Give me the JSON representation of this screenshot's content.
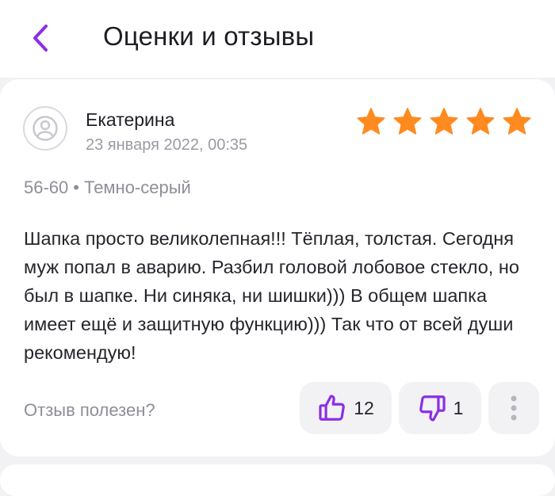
{
  "header": {
    "title": "Оценки и отзывы",
    "back_icon": "chevron-left-icon"
  },
  "review": {
    "author": "Екатерина",
    "date": "23 января 2022, 00:35",
    "rating": 5,
    "rating_max": 5,
    "size": "56-60",
    "separator": "•",
    "color": "Темно-серый",
    "text": "Шапка просто великолепная!!! Тёплая, толстая. Сегодня муж попал в аварию. Разбил головой лобовое стекло, но был в шапке. Ни синяка, ни шишки))) В общем шапка имеет ещё и защитную функцию))) Так что от всей души рекомендую!",
    "helpful_label": "Отзыв полезен?",
    "likes": "12",
    "dislikes": "1"
  },
  "colors": {
    "accent": "#8b2ee6",
    "star": "#ff8a1f",
    "background": "#f2f2f4"
  }
}
